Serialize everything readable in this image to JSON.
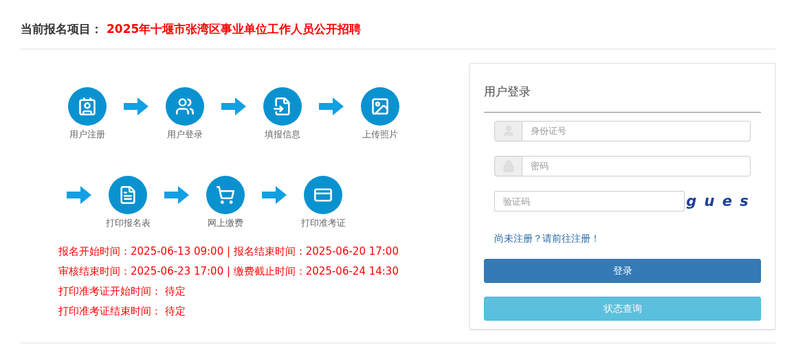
{
  "header": {
    "label": "当前报名项目：",
    "project": "2025年十堰市张湾区事业单位工作人员公开招聘"
  },
  "steps": [
    [
      {
        "kind": "register",
        "label": "用户注册"
      },
      {
        "kind": "login",
        "label": "用户登录"
      },
      {
        "kind": "fill",
        "label": "填报信息"
      },
      {
        "kind": "photo",
        "label": "上传照片"
      }
    ],
    [
      {
        "kind": "form",
        "label": "打印报名表"
      },
      {
        "kind": "pay",
        "label": "网上缴费"
      },
      {
        "kind": "ticket",
        "label": "打印准考证"
      }
    ]
  ],
  "schedule": [
    "报名开始时间：2025-06-13 09:00 | 报名结束时间：2025-06-20 17:00",
    "审核结束时间：2025-06-23 17:00 | 缴费截止时间：2025-06-24 14:30",
    "打印准考证开始时间： 待定",
    "打印准考证结束时间： 待定"
  ],
  "login": {
    "title": "用户登录",
    "id_placeholder": "身份证号",
    "password_placeholder": "密码",
    "captcha_placeholder": "验证码",
    "captcha": "g u e s",
    "register_link": "尚未注册？请前往注册！",
    "login_button": "登录",
    "status_button": "状态查询"
  }
}
